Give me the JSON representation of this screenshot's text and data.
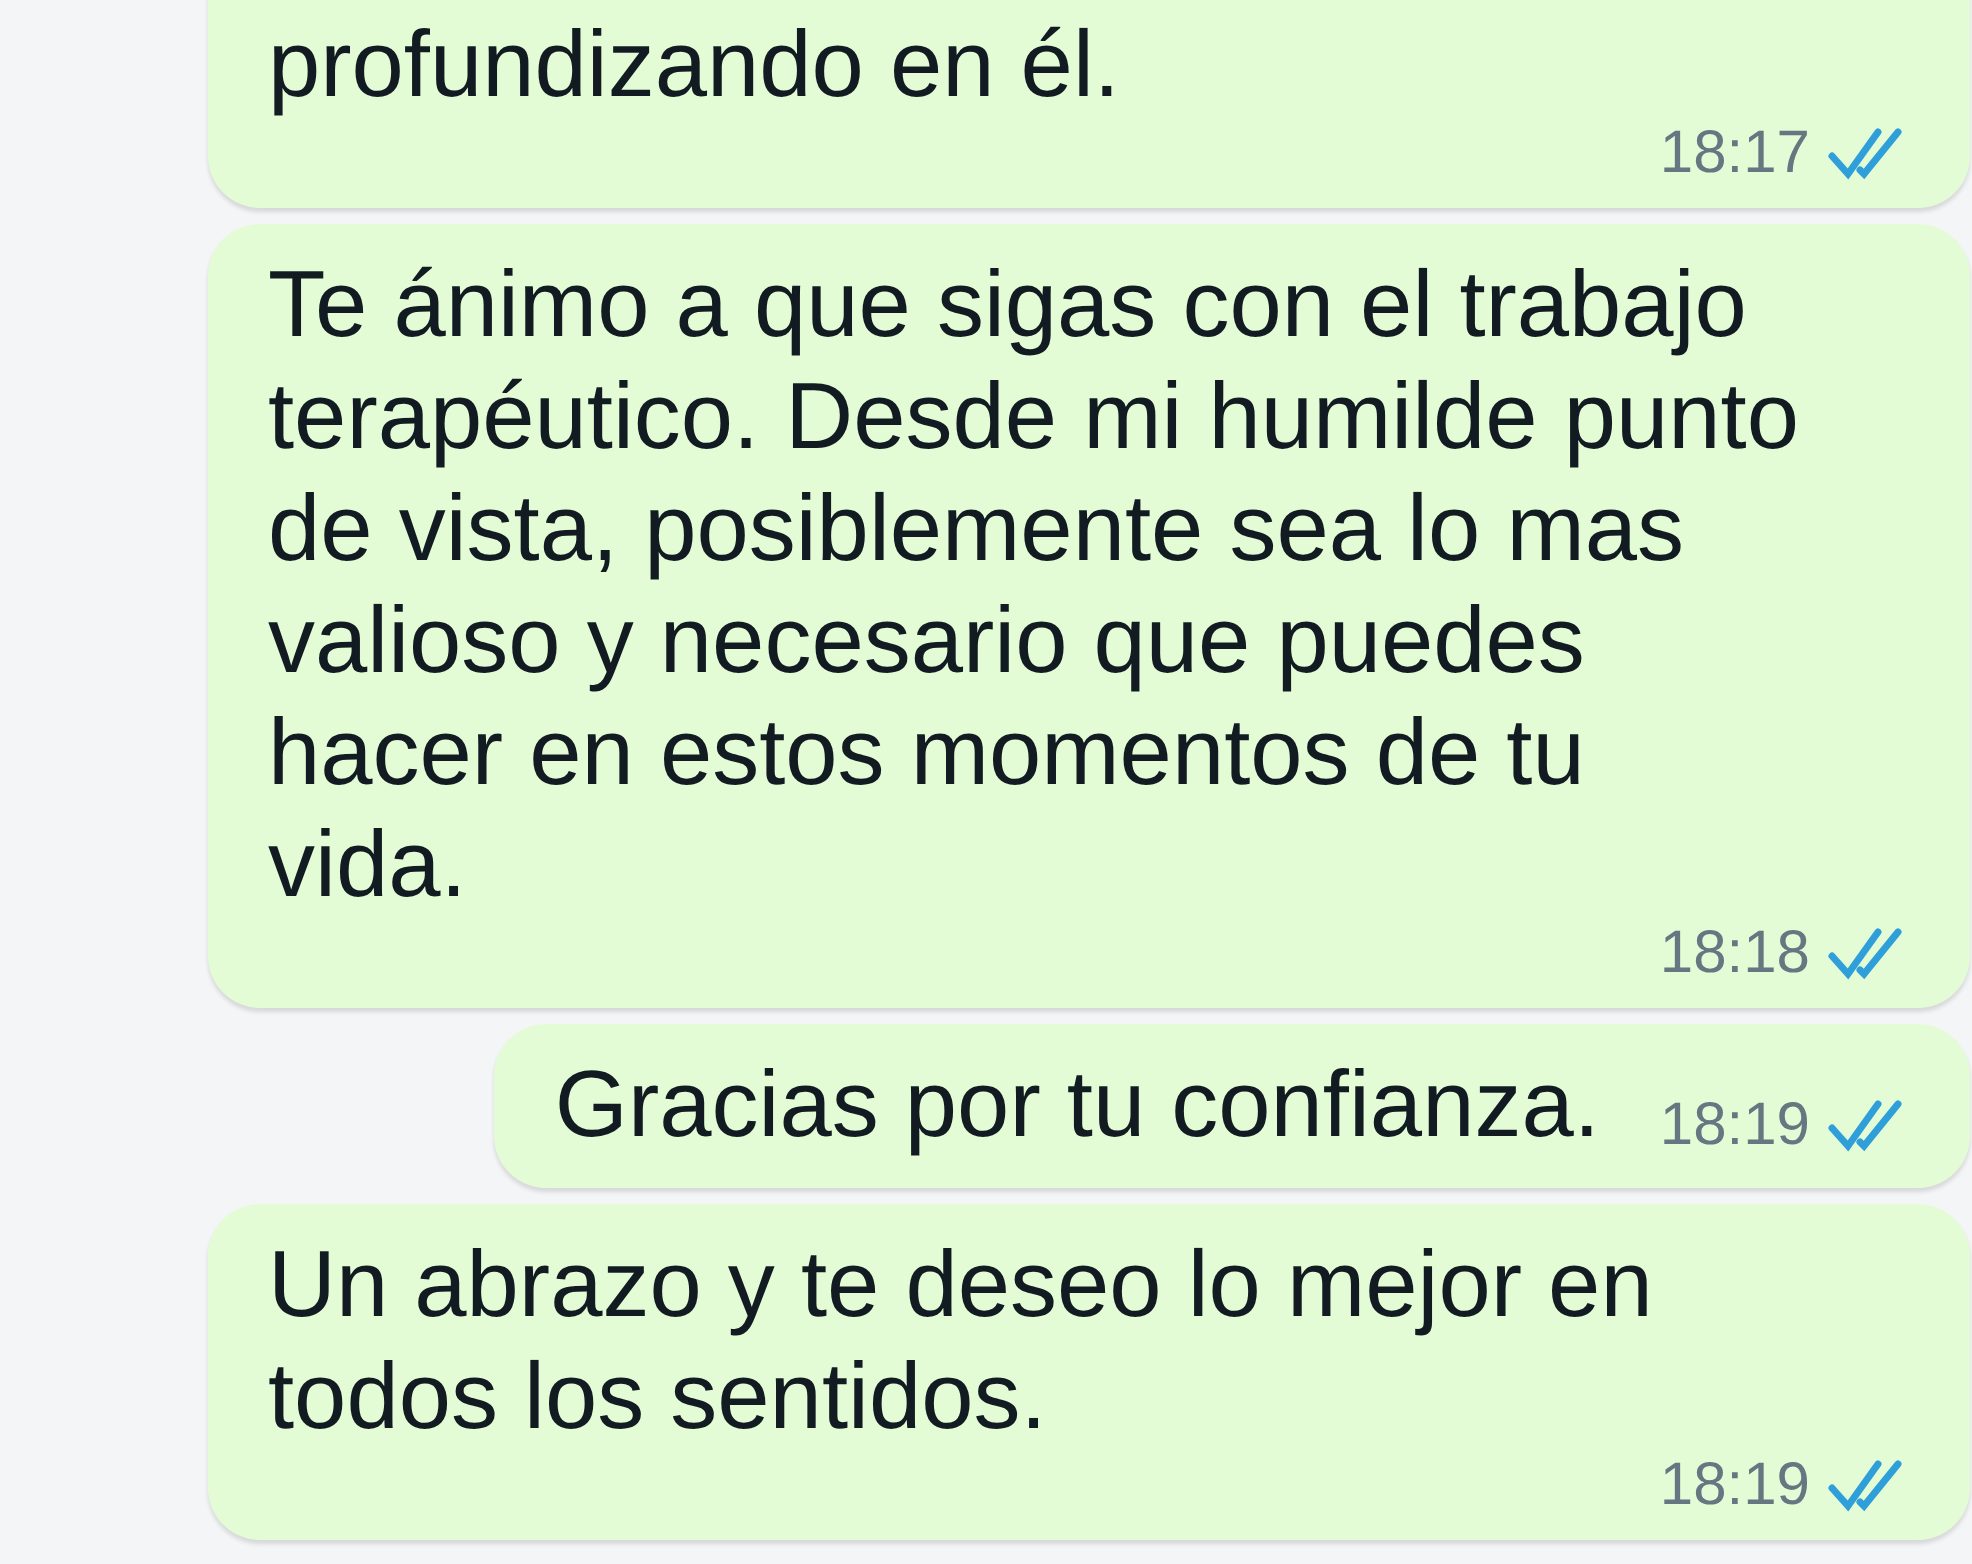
{
  "messages": [
    {
      "text": "profundizando en él.",
      "time": "18:17",
      "read": true,
      "outgoing": true,
      "continued": true
    },
    {
      "text": "Te ánimo a que sigas con el trabajo\nterapéutico. Desde mi humilde punto\nde vista, posiblemente sea lo mas\nvalioso y necesario que puedes\nhacer en estos momentos de tu\nvida.",
      "time": "18:18",
      "read": true,
      "outgoing": true,
      "continued": false
    },
    {
      "text": "Gracias por tu confianza.",
      "time": "18:19",
      "read": true,
      "outgoing": true,
      "continued": false
    },
    {
      "text": "Un abrazo y te deseo lo mejor en\ntodos los sentidos.",
      "time": "18:19",
      "read": true,
      "outgoing": true,
      "continued": false
    }
  ]
}
